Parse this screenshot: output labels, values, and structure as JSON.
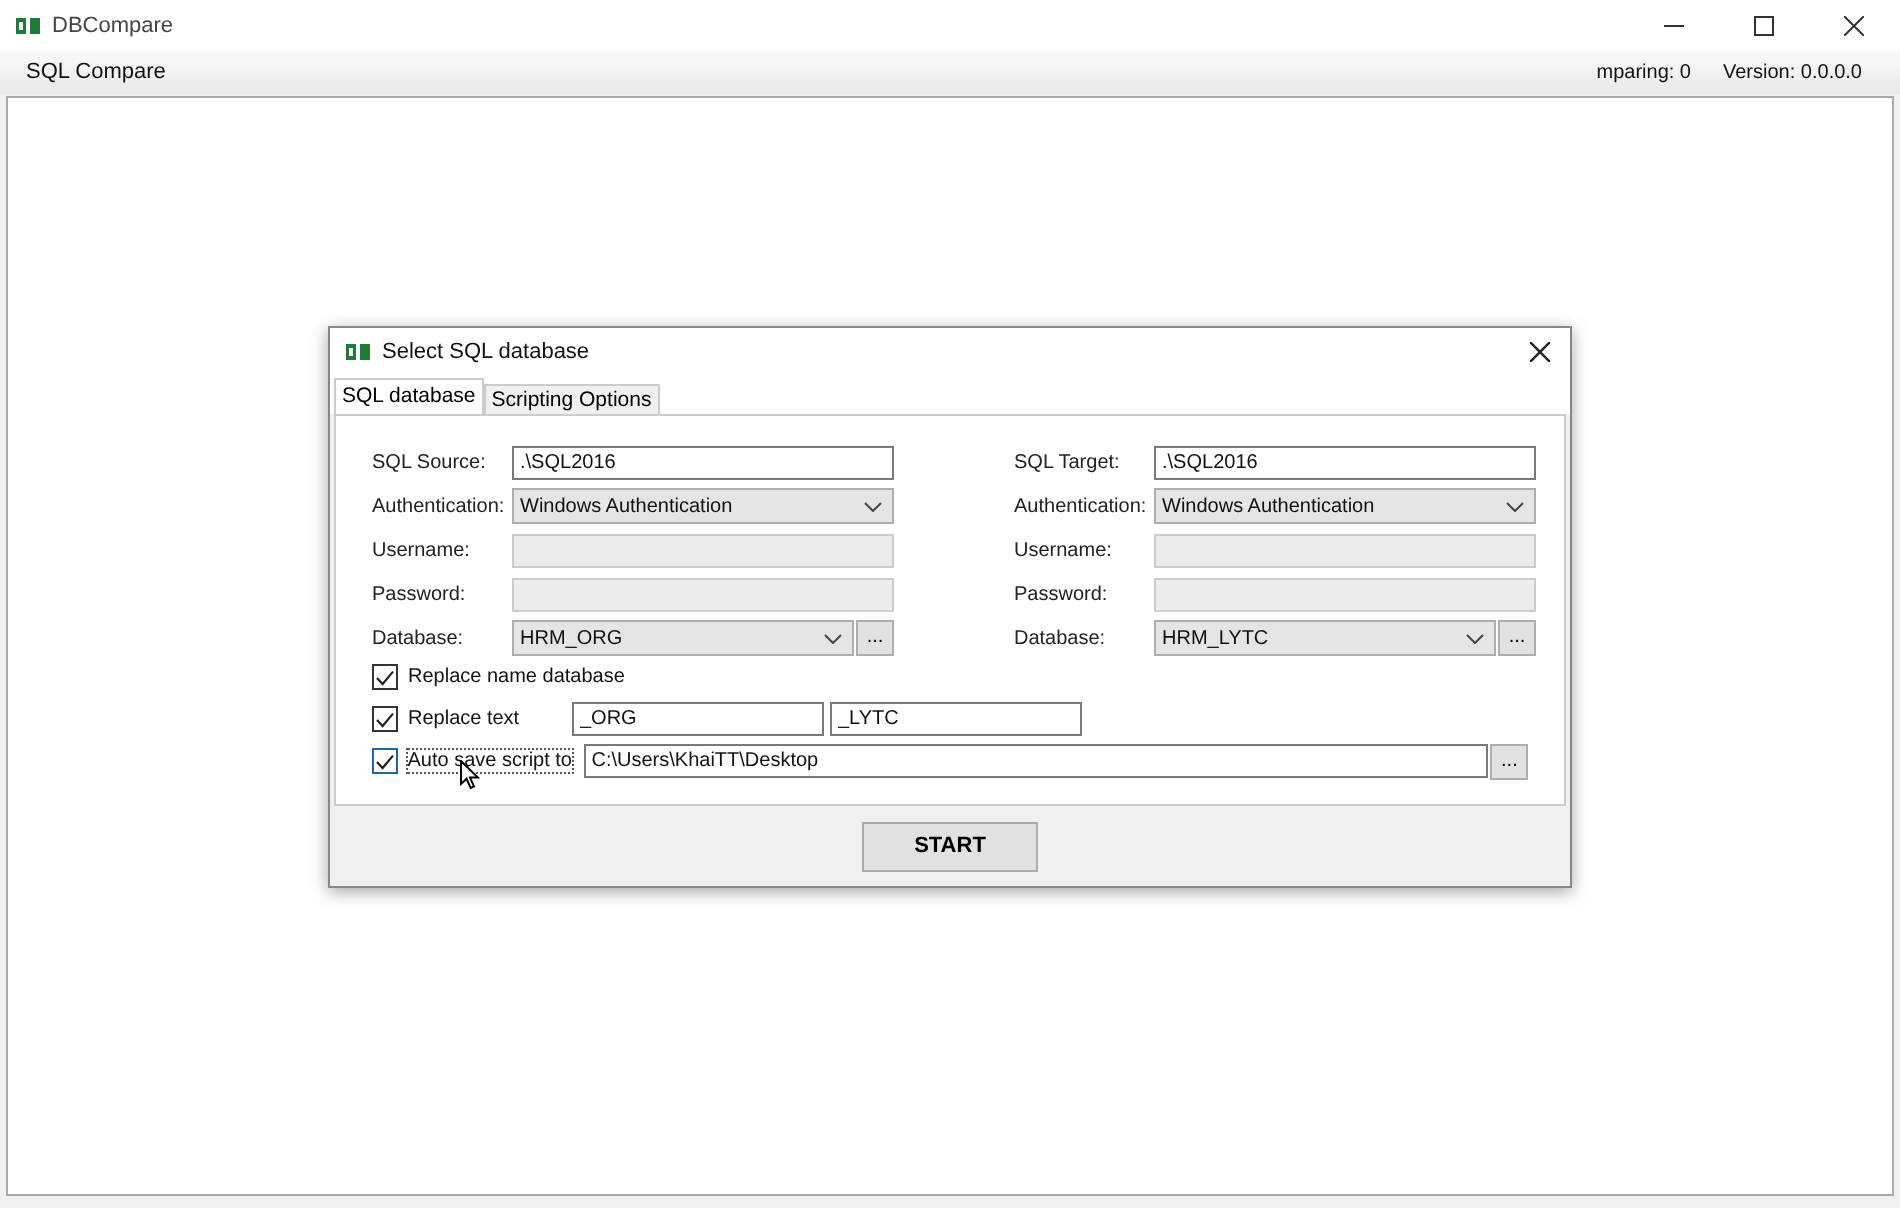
{
  "window": {
    "title": "DBCompare",
    "menu": [
      "SQL Compare"
    ],
    "status": [
      "mparing: 0",
      "Version: 0.0.0.0"
    ]
  },
  "dialog": {
    "title": "Select SQL database",
    "tabs": [
      {
        "label": "SQL database",
        "selected": true
      },
      {
        "label": "Scripting Options",
        "selected": false
      }
    ],
    "columns": [
      {
        "fields": [
          {
            "kind": "input",
            "label": "SQL Source:",
            "value": ".\\SQL2016",
            "disabled": false
          },
          {
            "kind": "dropdown",
            "label": "Authentication:",
            "value": "Windows Authentication"
          },
          {
            "kind": "input",
            "label": "Username:",
            "disabled": true
          },
          {
            "kind": "input",
            "label": "Password:",
            "disabled": true
          },
          {
            "kind": "dropdown-browse",
            "label": "Database:",
            "value": "HRM_ORG",
            "browse": "..."
          }
        ]
      },
      {
        "fields": [
          {
            "kind": "input",
            "label": "SQL Target:",
            "value": ".\\SQL2016",
            "disabled": false
          },
          {
            "kind": "dropdown",
            "label": "Authentication:",
            "value": "Windows Authentication"
          },
          {
            "kind": "input",
            "label": "Username:",
            "disabled": true
          },
          {
            "kind": "input",
            "label": "Password:",
            "disabled": true
          },
          {
            "kind": "dropdown-browse",
            "label": "Database:",
            "value": "HRM_LYTC",
            "browse": "..."
          }
        ]
      }
    ],
    "options": [
      {
        "kind": "plain",
        "label": "Replace name database",
        "checked": true
      },
      {
        "kind": "pair",
        "label": "Replace text",
        "checked": true,
        "values": [
          "_ORG",
          "_LYTC"
        ]
      },
      {
        "kind": "path",
        "label": "Auto save script to",
        "checked": true,
        "values": [
          "C:\\Users\\KhaiTT\\Desktop"
        ],
        "browse": "..."
      }
    ],
    "start": "START"
  }
}
